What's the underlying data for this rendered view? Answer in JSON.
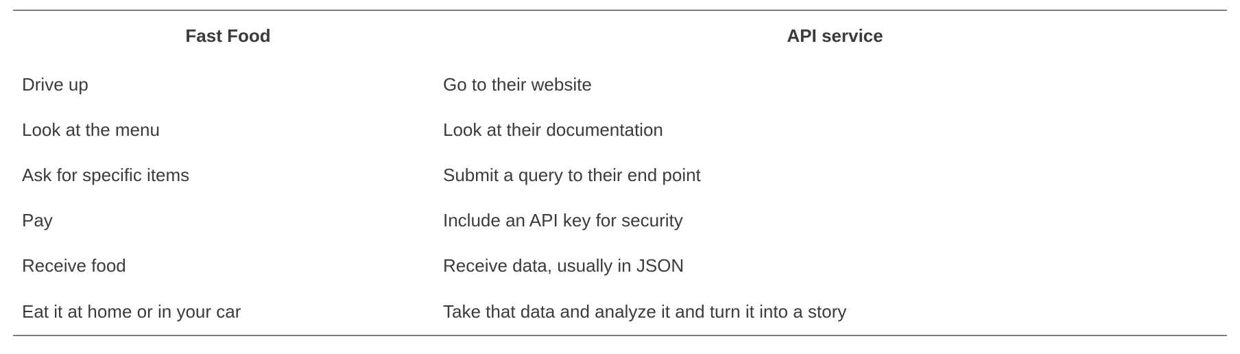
{
  "table": {
    "headers": [
      "Fast Food",
      "API service"
    ],
    "rows": [
      [
        "Drive up",
        "Go to their website"
      ],
      [
        "Look at the menu",
        "Look at their documentation"
      ],
      [
        "Ask for specific items",
        "Submit a query to their end point"
      ],
      [
        "Pay",
        "Include an API key for security"
      ],
      [
        "Receive food",
        "Receive data, usually in JSON"
      ],
      [
        "Eat it at home or in your car",
        "Take that data and analyze it and turn it into a story"
      ]
    ]
  }
}
